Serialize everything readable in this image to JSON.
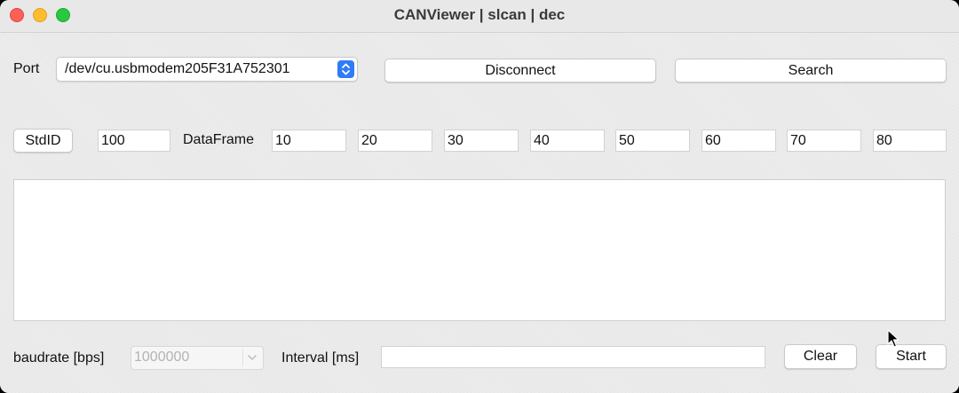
{
  "window": {
    "title": "CANViewer | slcan | dec"
  },
  "connection": {
    "port_label": "Port",
    "port_value": "/dev/cu.usbmodem205F31A752301",
    "disconnect_label": "Disconnect",
    "search_label": "Search"
  },
  "frame": {
    "id_type_label": "StdID",
    "id_value": "100",
    "dataframe_label": "DataFrame",
    "bytes": [
      "10",
      "20",
      "30",
      "40",
      "50",
      "60",
      "70",
      "80"
    ]
  },
  "log": {
    "text": ""
  },
  "footer": {
    "baudrate_label": "baudrate [bps]",
    "baudrate_value": "1000000",
    "interval_label": "Interval [ms]",
    "interval_value": "",
    "clear_label": "Clear",
    "start_label": "Start"
  },
  "icons": {
    "port_stepper": "chevron-up-down-icon",
    "baudrate_dropdown": "chevron-down-icon",
    "cursor": "mouse-pointer-icon"
  },
  "colors": {
    "accent": "#2f7cf6",
    "close": "#fe5f57",
    "minimize": "#febc2e",
    "maximize": "#28c840"
  }
}
